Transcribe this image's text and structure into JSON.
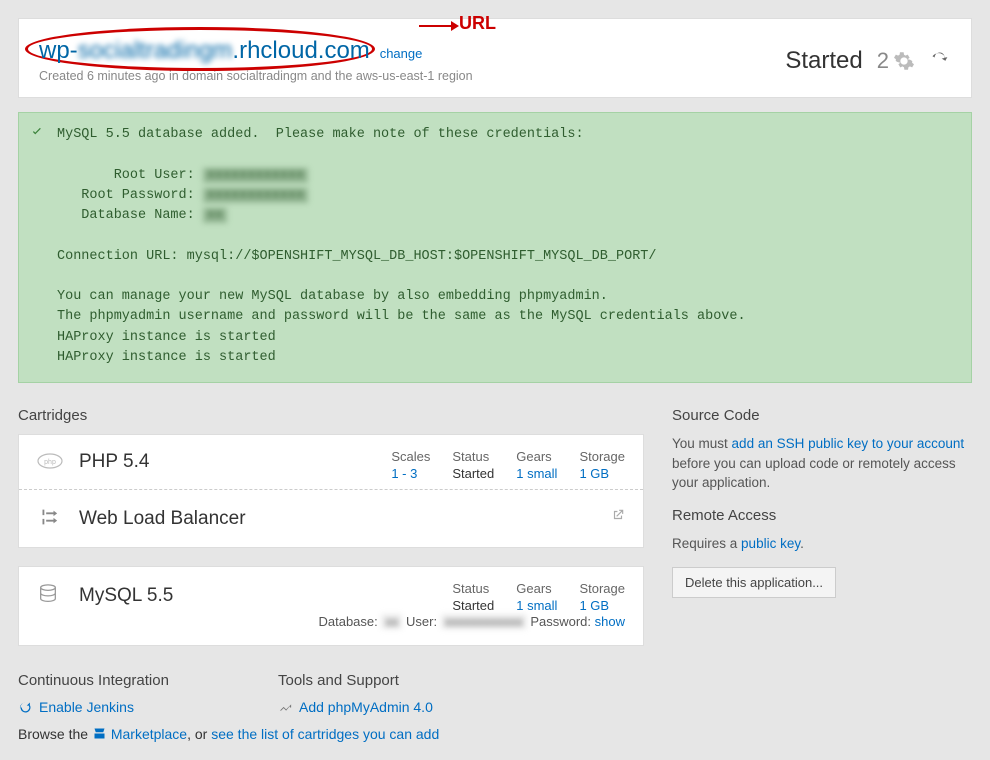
{
  "annotation": {
    "url_label": "URL"
  },
  "header": {
    "url_prefix": "wp-",
    "url_blur": "socialtradingm",
    "url_suffix": ".rhcloud.com",
    "change": "change",
    "subtext_prefix": "Created 6 minutes ago in domain ",
    "subtext_domain": "socialtradingm",
    "subtext_suffix": " and the aws-us-east-1 region",
    "status": "Started",
    "gear_count": "2"
  },
  "alert": {
    "line1": "MySQL 5.5 database added.  Please make note of these credentials:",
    "root_user_label": "       Root User: ",
    "root_password_label": "   Root Password: ",
    "database_name_label": "   Database Name: ",
    "conn": "Connection URL: mysql://$OPENSHIFT_MYSQL_DB_HOST:$OPENSHIFT_MYSQL_DB_PORT/",
    "l5": "You can manage your new MySQL database by also embedding phpmyadmin.",
    "l6": "The phpmyadmin username and password will be the same as the MySQL credentials above.",
    "l7": "HAProxy instance is started",
    "l8": "HAProxy instance is started"
  },
  "sections": {
    "cartridges": "Cartridges",
    "source_code": "Source Code",
    "remote_access": "Remote Access",
    "ci": "Continuous Integration",
    "tools": "Tools and Support"
  },
  "cartridges": {
    "php": {
      "name": "PHP 5.4",
      "scales_label": "Scales",
      "scales_val": "1 - 3",
      "status_label": "Status",
      "status_val": "Started",
      "gears_label": "Gears",
      "gears_val": "1 small",
      "storage_label": "Storage",
      "storage_val": "1 GB"
    },
    "lb": {
      "name": "Web Load Balancer"
    },
    "mysql": {
      "name": "MySQL 5.5",
      "status_label": "Status",
      "status_val": "Started",
      "gears_label": "Gears",
      "gears_val": "1 small",
      "storage_label": "Storage",
      "storage_val": "1 GB",
      "db_label": "Database:",
      "user_label": "User:",
      "pass_label": "Password:",
      "show": "show"
    }
  },
  "right": {
    "src_prefix": "You must ",
    "src_link": "add an SSH public key to your account",
    "src_suffix": " before you can upload code or remotely access your application.",
    "ra_prefix": "Requires a ",
    "ra_link": "public key",
    "ra_suffix": ".",
    "delete": "Delete this application..."
  },
  "ci": {
    "enable": "Enable Jenkins"
  },
  "tools": {
    "add_pma": "Add phpMyAdmin 4.0"
  },
  "browse": {
    "prefix": "Browse the ",
    "marketplace": "Marketplace",
    "mid": ", or ",
    "list": "see the list of cartridges you can add"
  }
}
